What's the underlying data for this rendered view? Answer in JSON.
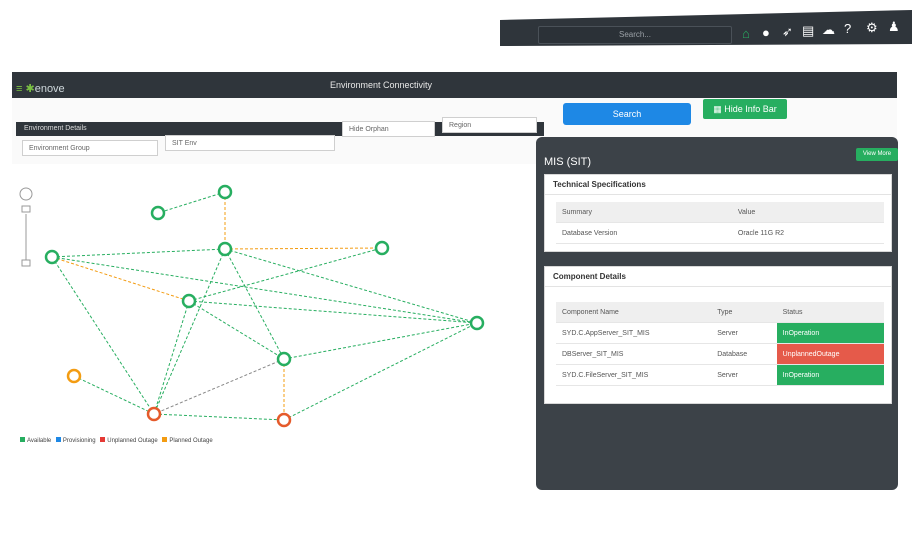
{
  "topbar": {
    "search_placeholder": "Search...",
    "icons": [
      "home-icon",
      "circle-icon",
      "rocket-icon",
      "calendar-icon",
      "cloud-icon",
      "help-icon",
      "gear-icon",
      "user-icon"
    ]
  },
  "header": {
    "logo": "enove",
    "title": "Environment Connectivity"
  },
  "filters": {
    "section_label": "Environment Details",
    "environment_group": "Environment Group",
    "environment": "SIT Env",
    "hide_orphan": "Hide Orphan",
    "region": "Region",
    "search_button": "Search",
    "hide_info_button": "Hide Info Bar"
  },
  "legend": [
    {
      "label": "Available",
      "color": "#27ae60"
    },
    {
      "label": "Provisioning",
      "color": "#1e88e5"
    },
    {
      "label": "Unplanned Outage",
      "color": "#e53935"
    },
    {
      "label": "Planned Outage",
      "color": "#f39c12"
    }
  ],
  "panel": {
    "title": "MIS (SIT)",
    "view_more": "View More",
    "tech_title": "Technical Specifications",
    "tech_headers": [
      "Summary",
      "Value"
    ],
    "tech_rows": [
      [
        "Database Version",
        "Oracle 11G R2"
      ]
    ],
    "comp_title": "Component Details",
    "comp_headers": [
      "Component Name",
      "Type",
      "Status"
    ],
    "comp_rows": [
      [
        "SYD.C.AppServer_SIT_MIS",
        "Server",
        "InOperation"
      ],
      [
        "DBServer_SIT_MIS",
        "Database",
        "UnplannedOutage"
      ],
      [
        "SYD.C.FileServer_SIT_MIS",
        "Server",
        "InOperation"
      ]
    ]
  }
}
